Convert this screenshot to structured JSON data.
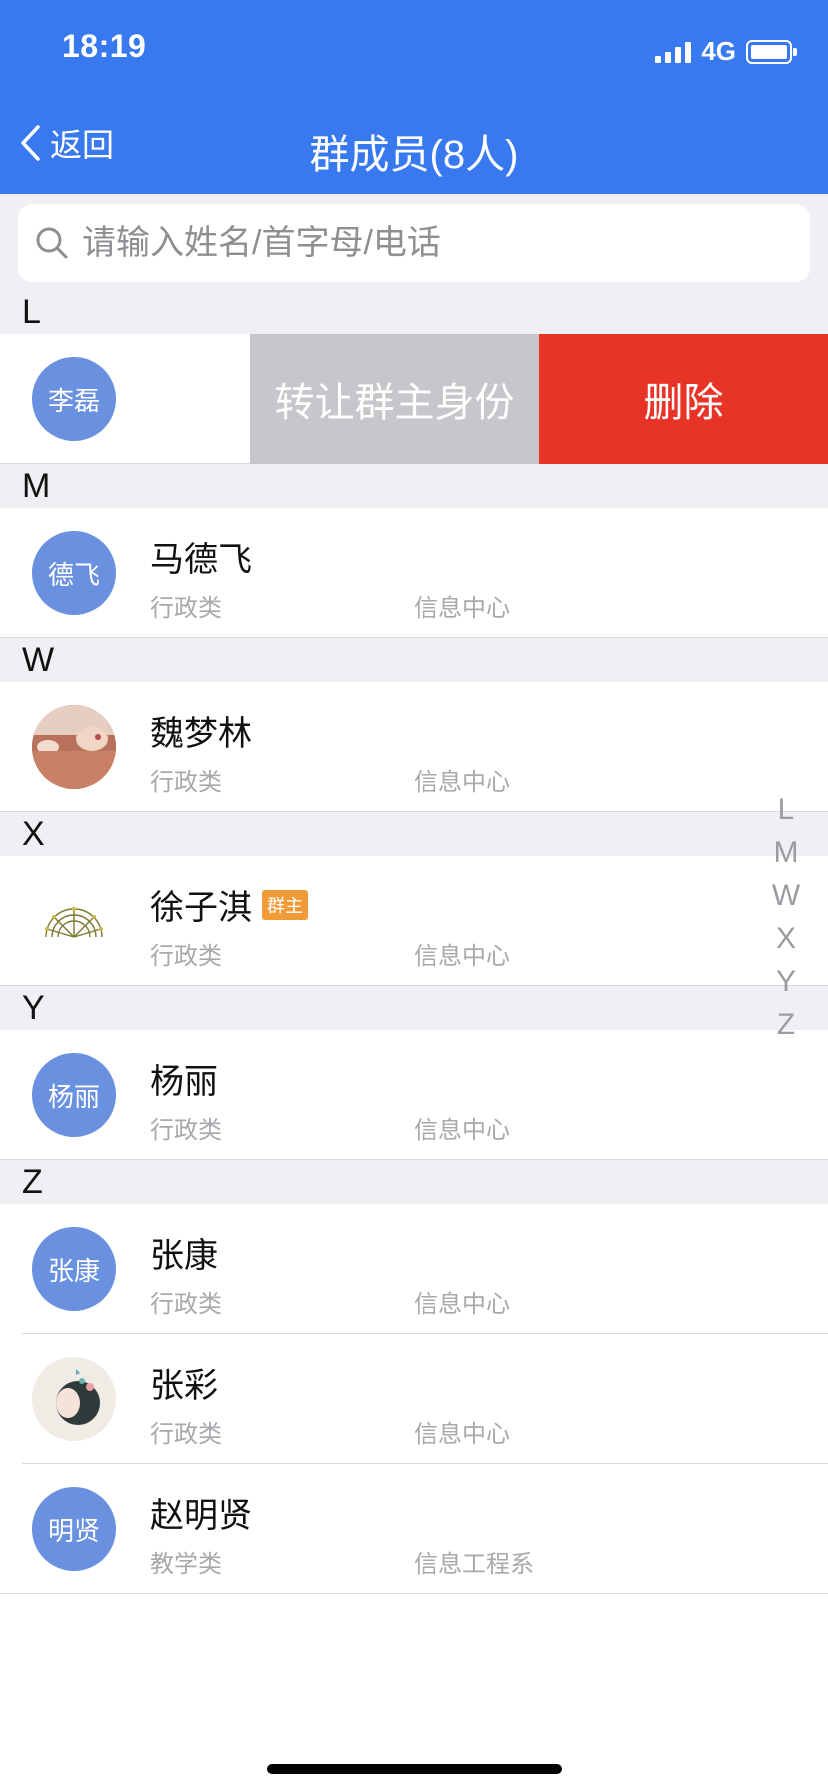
{
  "status_bar": {
    "time": "18:19",
    "network": "4G"
  },
  "nav": {
    "back_label": "返回",
    "title": "群成员(8人)"
  },
  "search": {
    "placeholder": "请输入姓名/首字母/电话"
  },
  "swipe_actions": {
    "transfer": "转让群主身份",
    "delete": "删除"
  },
  "sections": [
    {
      "letter": "L",
      "members": [
        {
          "avatar_text": "李磊"
        }
      ]
    },
    {
      "letter": "M",
      "members": [
        {
          "avatar_text": "德飞",
          "name": "马德飞",
          "category": "行政类",
          "dept": "信息中心"
        }
      ]
    },
    {
      "letter": "W",
      "members": [
        {
          "avatar_image": "photo",
          "name": "魏梦林",
          "category": "行政类",
          "dept": "信息中心"
        }
      ]
    },
    {
      "letter": "X",
      "members": [
        {
          "avatar_image": "fan-pattern",
          "name": "徐子淇",
          "badge": "群主",
          "category": "行政类",
          "dept": "信息中心"
        }
      ]
    },
    {
      "letter": "Y",
      "members": [
        {
          "avatar_text": "杨丽",
          "name": "杨丽",
          "category": "行政类",
          "dept": "信息中心"
        }
      ]
    },
    {
      "letter": "Z",
      "members": [
        {
          "avatar_text": "张康",
          "name": "张康",
          "category": "行政类",
          "dept": "信息中心"
        },
        {
          "avatar_image": "illustration",
          "name": "张彩",
          "category": "行政类",
          "dept": "信息中心"
        },
        {
          "avatar_text": "明贤",
          "name": "赵明贤",
          "category": "教学类",
          "dept": "信息工程系"
        }
      ]
    }
  ],
  "index_letters": [
    "L",
    "M",
    "W",
    "X",
    "Y",
    "Z"
  ],
  "colors": {
    "primary": "#3879f0",
    "delete": "#e83427",
    "transfer": "#c6c6cb",
    "avatar": "#6a90e0",
    "badge": "#f19a38"
  }
}
